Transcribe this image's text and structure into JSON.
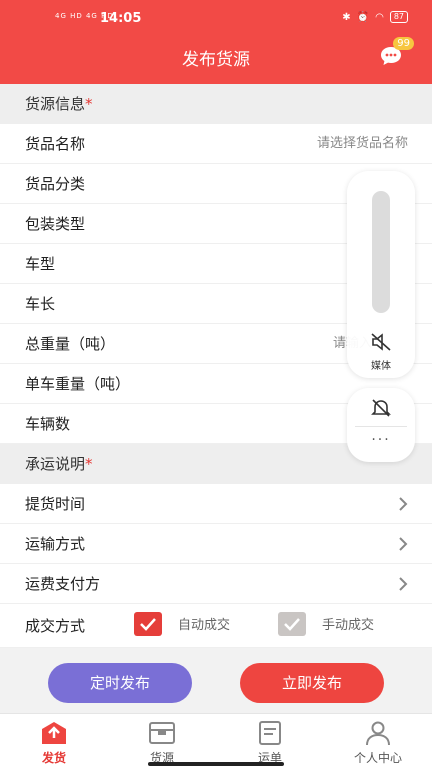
{
  "status": {
    "time": "14:05",
    "signal": "4G HD 4G HD",
    "battery": "87"
  },
  "header": {
    "title": "发布货源",
    "badge": "99"
  },
  "section_cargo": {
    "title": "货源信息",
    "star": "*"
  },
  "cargo_rows": [
    {
      "label": "货品名称",
      "placeholder": "请选择货品名称"
    },
    {
      "label": "货品分类"
    },
    {
      "label": "包装类型"
    },
    {
      "label": "车型"
    },
    {
      "label": "车长"
    },
    {
      "label": "总重量（吨）",
      "placeholder": "请输入"
    },
    {
      "label": "单车重量（吨）"
    },
    {
      "label": "车辆数"
    }
  ],
  "section_transport": {
    "title": "承运说明",
    "star": "*"
  },
  "transport_rows": [
    {
      "label": "提货时间"
    },
    {
      "label": "运输方式"
    },
    {
      "label": "运费支付方"
    }
  ],
  "deal": {
    "label": "成交方式",
    "auto": "自动成交",
    "manual": "手动成交",
    "selected": "auto"
  },
  "actions": {
    "timed": "定时发布",
    "now": "立即发布"
  },
  "nav": [
    {
      "label": "发货",
      "icon": "ship-box-icon",
      "active": true
    },
    {
      "label": "货源",
      "icon": "cargo-box-icon",
      "active": false
    },
    {
      "label": "运单",
      "icon": "waybill-icon",
      "active": false
    },
    {
      "label": "个人中心",
      "icon": "user-icon",
      "active": false
    }
  ],
  "overlay": {
    "media_label": "媒体",
    "more": "···"
  },
  "colors": {
    "primary": "#f24a46",
    "timed_button": "#7a6fd6",
    "now_button": "#ee4540",
    "badge": "#f7c640"
  }
}
